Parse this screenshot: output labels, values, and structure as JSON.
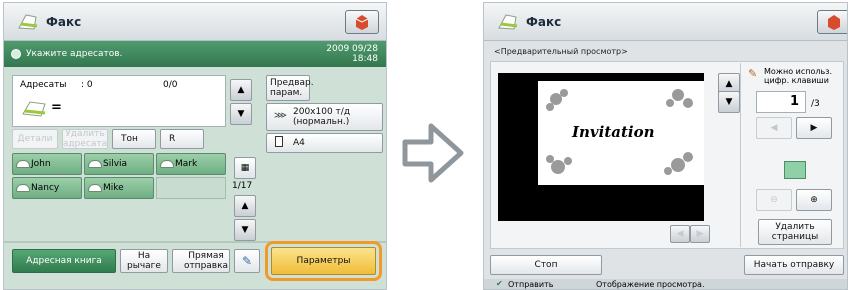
{
  "left_screen": {
    "title": "Факс",
    "instruction": "Укажите адресатов.",
    "date": "2009 09/28",
    "time": "18:48",
    "recipients_label": "Адресаты",
    "recipients_count": ": 0",
    "recipients_ratio": "0/0",
    "equals_sign": "=",
    "buttons": {
      "details": "Детали",
      "delete_recipient": "Удалить адресата",
      "tone": "Тон",
      "r": "R",
      "address_book": "Адресная книга",
      "on_hook": "На рычаге",
      "direct_send": "Прямая отправка",
      "params": "Параметры"
    },
    "settings": {
      "preset": "Предвар. парам.",
      "resolution": "200x100 т/д (нормальн.)",
      "paper": "A4"
    },
    "one_touch": [
      "John",
      "Silvia",
      "Mark",
      "Nancy",
      "Mike"
    ],
    "page_indicator": "1/17"
  },
  "right_screen": {
    "title": "Факс",
    "preview_label": "<Предварительный просмотр>",
    "invitation_text": "Invitation",
    "can_use_keypad": "Можно использ. цифр. клавиши",
    "page_value": "1",
    "page_total": "/3",
    "delete_pages": "Удалить страницы",
    "stop": "Стоп",
    "start_send": "Начать отправку",
    "status_send": "Отправить",
    "status_preview": "Отображение просмотра."
  },
  "colors": {
    "accent_green": "#3f8a5c",
    "highlight_orange": "#f19a2a",
    "params_yellow": "#f4c64a"
  }
}
